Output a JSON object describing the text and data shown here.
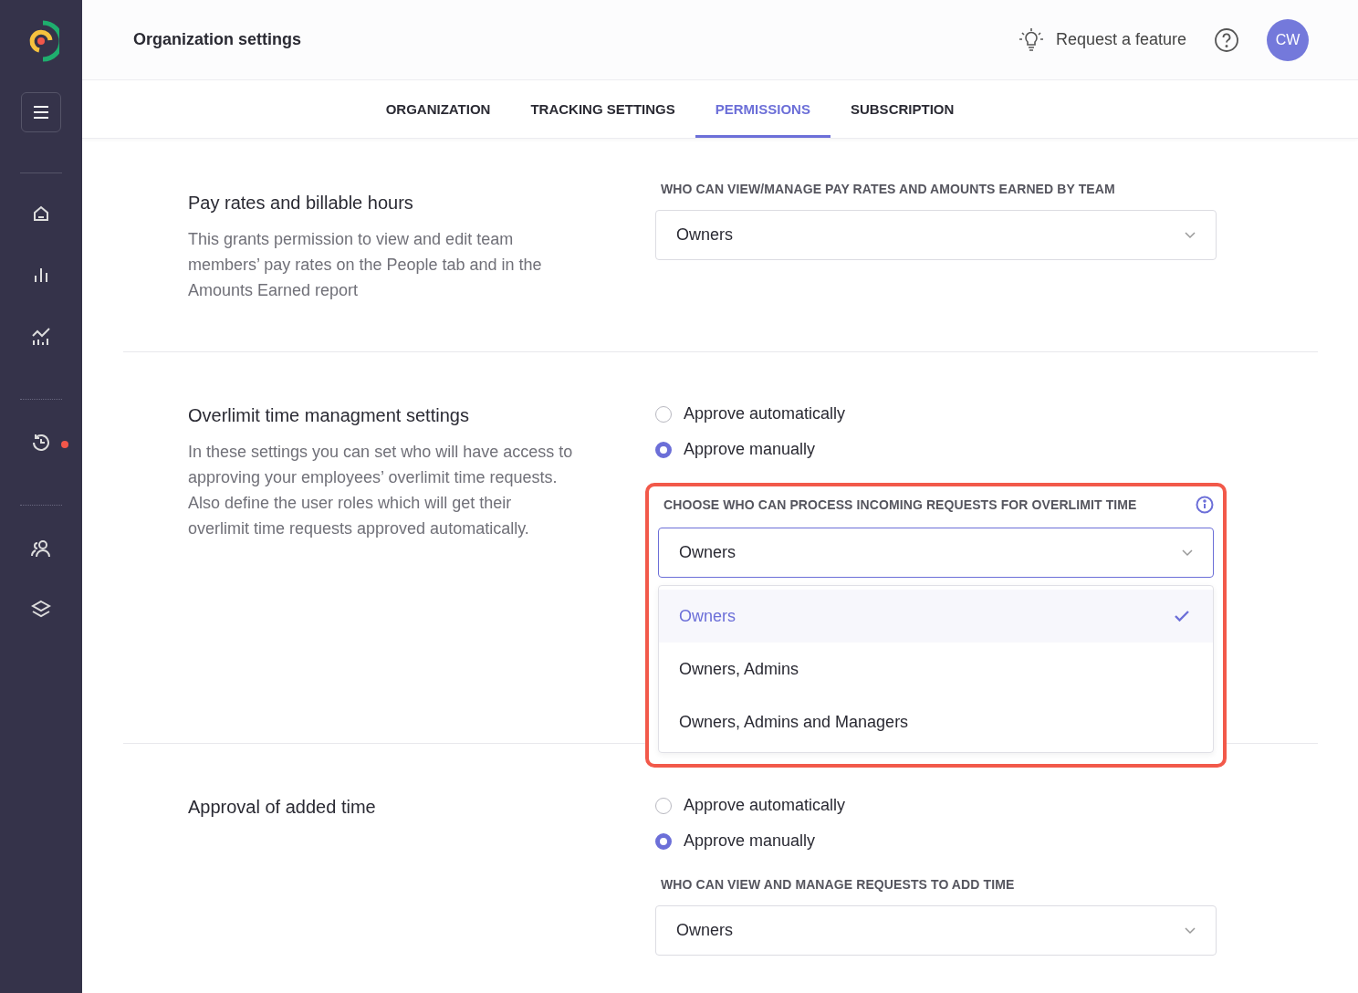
{
  "sidebar": {
    "items": [
      {
        "kind": "home",
        "notification": false
      },
      {
        "kind": "bars",
        "notification": false
      },
      {
        "kind": "trend",
        "notification": false
      },
      {
        "kind": "divider"
      },
      {
        "kind": "history",
        "notification": true
      },
      {
        "kind": "divider"
      },
      {
        "kind": "people",
        "notification": false
      },
      {
        "kind": "layers",
        "notification": false
      }
    ]
  },
  "header": {
    "title": "Organization settings",
    "request_feature": "Request a feature",
    "avatar": "CW"
  },
  "tabs": [
    {
      "label": "ORGANIZATION",
      "selected": false
    },
    {
      "label": "TRACKING SETTINGS",
      "selected": false
    },
    {
      "label": "PERMISSIONS",
      "selected": true
    },
    {
      "label": "SUBSCRIPTION",
      "selected": false
    }
  ],
  "sections": [
    {
      "kind": "select",
      "title": "Pay rates and billable hours",
      "description": "This grants permission to view and edit team members’ pay rates on the People tab and in the Amounts Earned report",
      "field_label": "WHO CAN VIEW/MANAGE PAY RATES AND AMOUNTS EARNED BY TEAM",
      "highlighted": false,
      "info": false,
      "select": {
        "value": "Owners",
        "expanded": false
      }
    },
    {
      "kind": "radio-select",
      "title": "Overlimit time managment settings",
      "description": "In these settings you can set who will have access to approving your employees’ overlimit time requests. Also define the user roles which will get their overlimit time requests approved automatically.",
      "options": [
        {
          "label": "Approve automatically",
          "selected": false
        },
        {
          "label": "Approve manually",
          "selected": true
        }
      ],
      "field_label": "CHOOSE WHO CAN PROCESS INCOMING REQUESTS FOR OVERLIMIT TIME",
      "highlighted": true,
      "info": true,
      "select": {
        "value": "Owners",
        "expanded": true,
        "options": [
          {
            "label": "Owners",
            "selected": true
          },
          {
            "label": "Owners, Admins",
            "selected": false
          },
          {
            "label": "Owners, Admins and Managers",
            "selected": false
          }
        ]
      }
    },
    {
      "kind": "radio-select",
      "title": "Approval of added time",
      "options": [
        {
          "label": "Approve automatically",
          "selected": false
        },
        {
          "label": "Approve manually",
          "selected": true
        }
      ],
      "field_label": "WHO CAN VIEW AND MANAGE REQUESTS TO ADD TIME",
      "highlighted": false,
      "info": false,
      "select": {
        "value": "Owners",
        "expanded": false
      }
    }
  ]
}
